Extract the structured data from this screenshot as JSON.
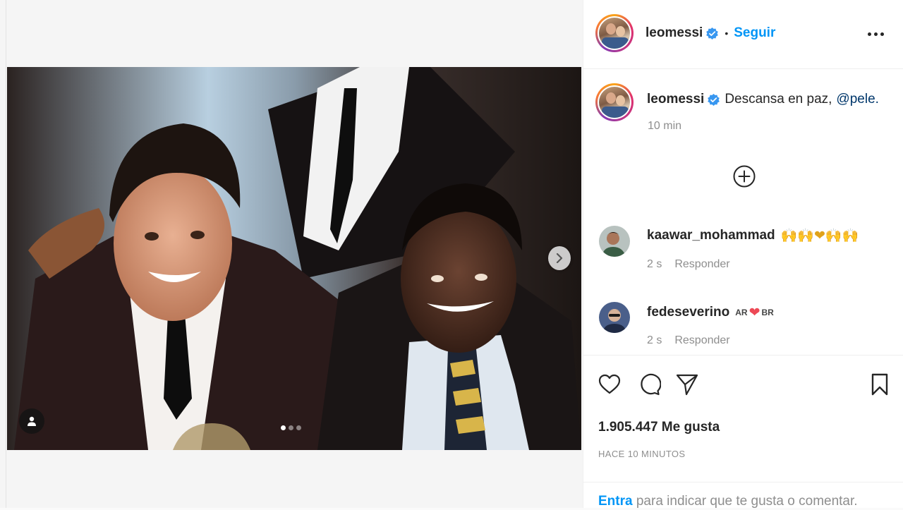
{
  "post": {
    "slide_count": 3,
    "active_slide": 1
  },
  "header": {
    "username": "leomessi",
    "separator": "•",
    "follow_label": "Seguir"
  },
  "caption": {
    "username": "leomessi",
    "text": "Descansa en paz,",
    "mention": "@pele.",
    "time": "10 min"
  },
  "comments": [
    {
      "username": "kaawar_mohammad",
      "text": "🙌🙌❤🙌🙌",
      "time": "2 s",
      "reply_label": "Responder"
    },
    {
      "username": "fedeseverino",
      "flag_left": "AR",
      "heart": "❤",
      "flag_right": "BR",
      "time": "2 s",
      "reply_label": "Responder"
    }
  ],
  "stats": {
    "likes": "1.905.447 Me gusta",
    "posted": "HACE 10 MINUTOS"
  },
  "login": {
    "link": "Entra",
    "text": " para indicar que te gusta o comentar."
  },
  "colors": {
    "accent": "#0095f6",
    "verified": "#3897f0",
    "muted": "#8e8e8e",
    "heart": "#ed4956"
  }
}
